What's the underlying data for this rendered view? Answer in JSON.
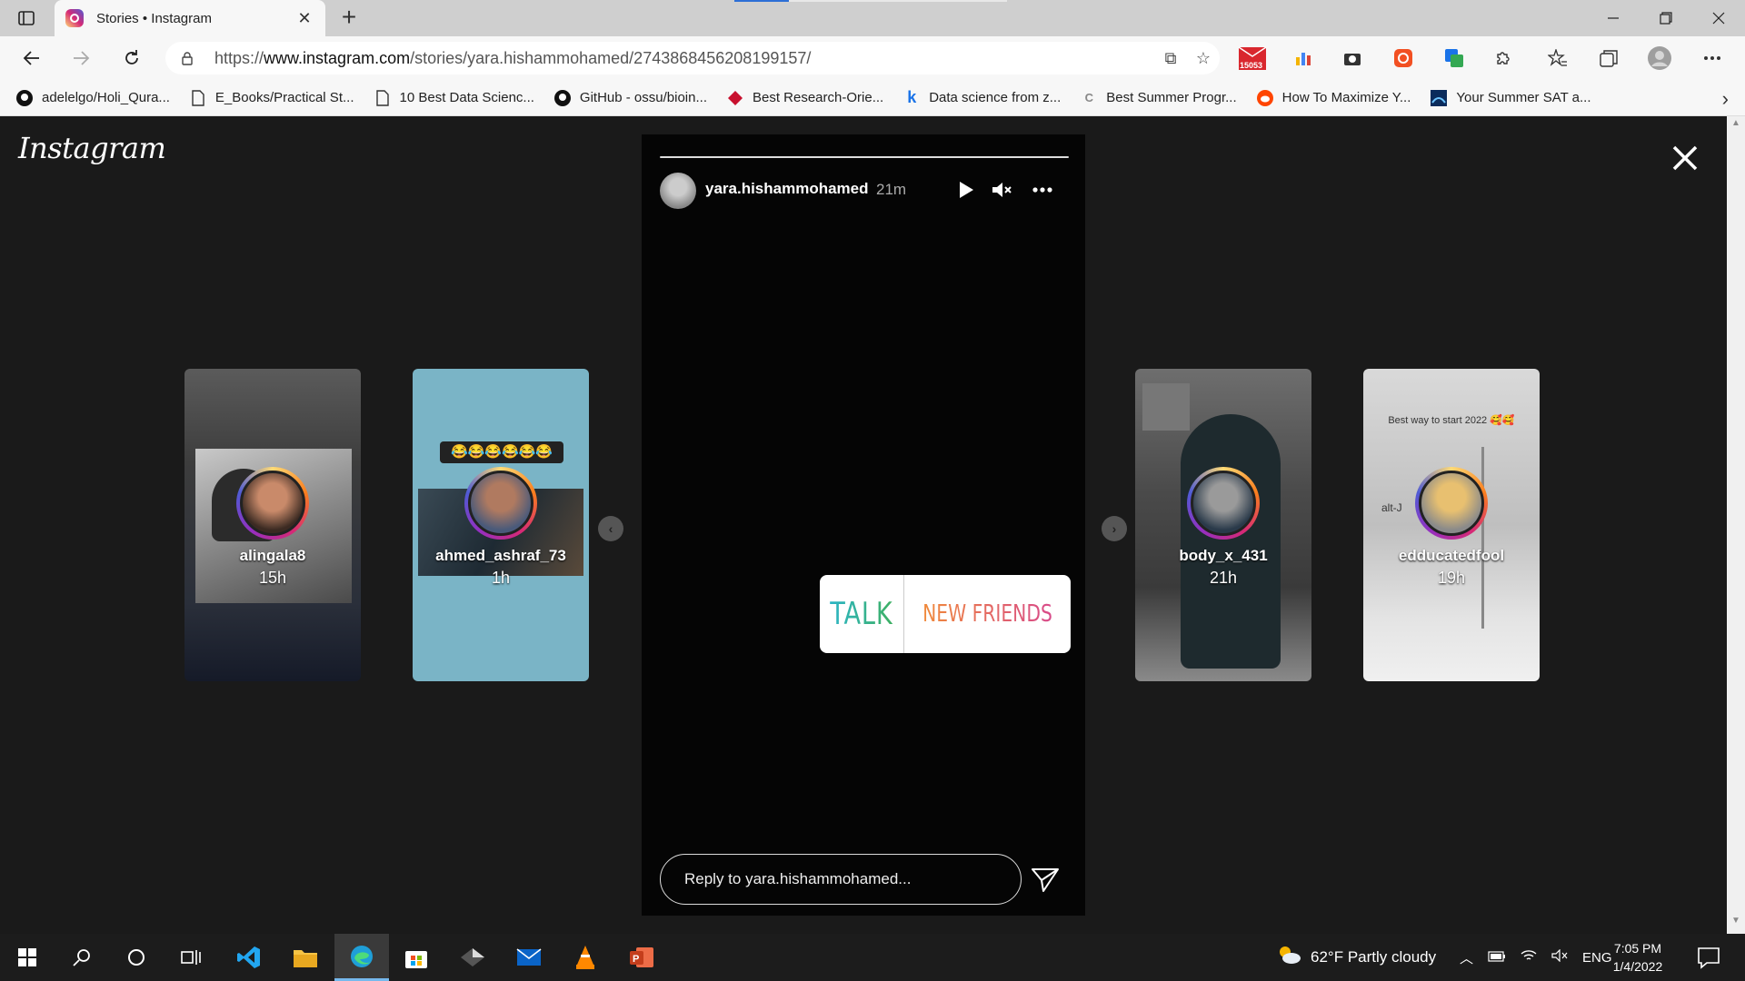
{
  "browser": {
    "tab_title": "Stories • Instagram",
    "tab_close": "✕",
    "new_tab": "+",
    "url_prefix": "https://",
    "url_host": "www.instagram.com",
    "url_path": "/stories/yara.hishammohamed/2743868456208199157/",
    "extension_badge": "15053",
    "bookmarks": [
      {
        "label": "adelelgo/Holi_Qura...",
        "icon": "github-icon"
      },
      {
        "label": "E_Books/Practical St...",
        "icon": "page-icon"
      },
      {
        "label": "10 Best Data Scienc...",
        "icon": "page-icon"
      },
      {
        "label": "GitHub - ossu/bioin...",
        "icon": "github-icon"
      },
      {
        "label": "Best Research-Orie...",
        "icon": "research-icon"
      },
      {
        "label": "Data science from z...",
        "icon": "k-icon"
      },
      {
        "label": "Best Summer Progr...",
        "icon": "c-icon"
      },
      {
        "label": "How To Maximize Y...",
        "icon": "reddit-icon"
      },
      {
        "label": "Your Summer SAT a...",
        "icon": "sat-icon"
      }
    ]
  },
  "instagram": {
    "logo": "Instagram",
    "side_stories": [
      {
        "username": "alingala8",
        "time": "15h"
      },
      {
        "username": "ahmed_ashraf_73",
        "time": "1h"
      },
      {
        "username": "body_x_431",
        "time": "21h"
      },
      {
        "username": "edducatedfool",
        "time": "19h"
      }
    ],
    "card_overlays": {
      "ahmed_emojis": "😂😂😂😂😂😂",
      "edducated_caption": "Best way to start 2022 🥰🥰",
      "edducated_tag": "alt-J"
    },
    "story": {
      "username": "yara.hishammohamed",
      "time": "21m",
      "sticker_left": "TALK",
      "sticker_right": "NEW FRIENDS",
      "reply_placeholder": "Reply to yara.hishammohamed...",
      "progress": 1.0
    }
  },
  "taskbar": {
    "weather": "62°F  Partly cloudy",
    "language": "ENG",
    "time": "7:05 PM",
    "date": "1/4/2022"
  },
  "colors": {
    "page_bg": "#1a1a1a",
    "story_bg": "#050505",
    "sticker_talk": "#2bb5c8",
    "sticker_friends": "#e0627a"
  }
}
